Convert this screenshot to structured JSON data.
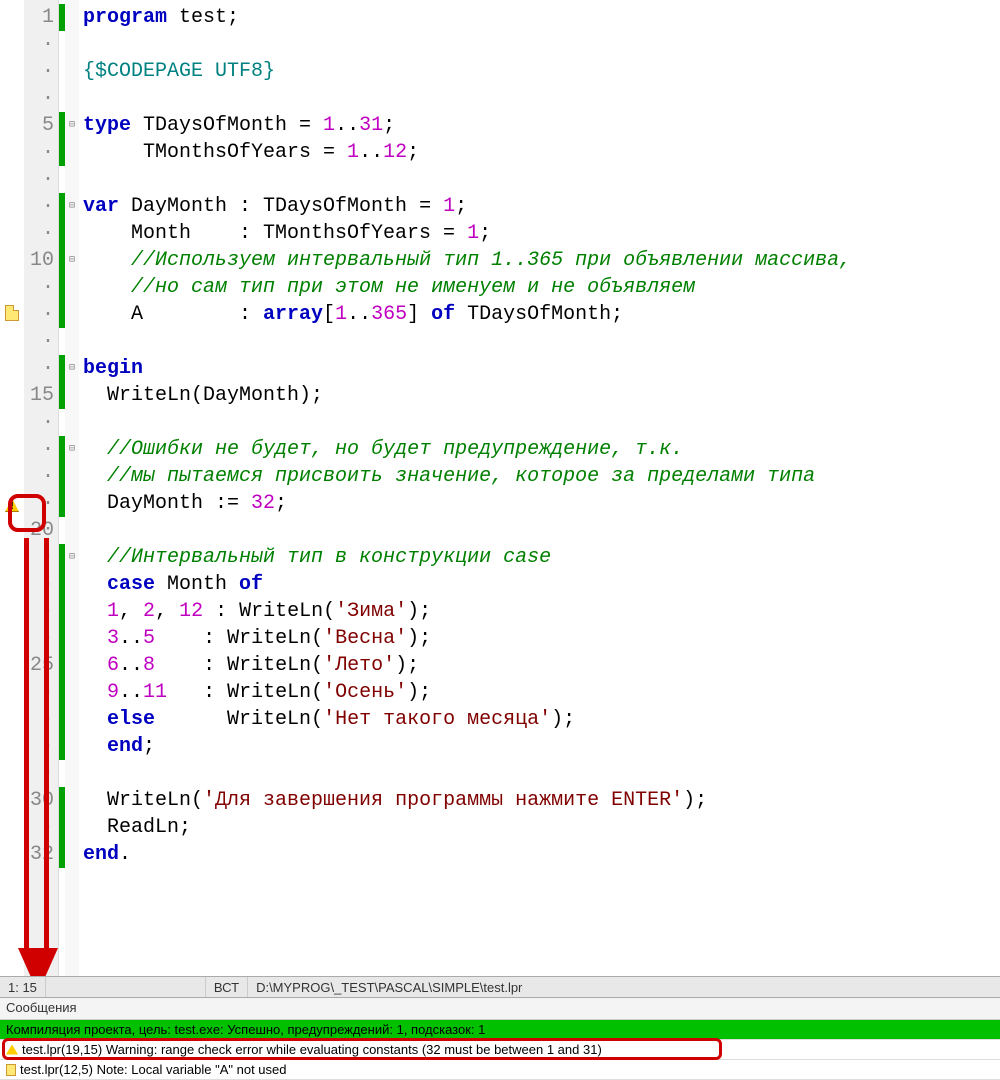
{
  "editor": {
    "lines": [
      {
        "n": "1",
        "t": [
          [
            "kw",
            "program"
          ],
          [
            "",
            " test;"
          ]
        ],
        "ch": true
      },
      {
        "n": "·",
        "t": [],
        "ch": false
      },
      {
        "n": "·",
        "t": [
          [
            "dir",
            "{$CODEPAGE UTF8}"
          ]
        ],
        "ch": false
      },
      {
        "n": "·",
        "t": [],
        "ch": false
      },
      {
        "n": "5",
        "t": [
          [
            "kw",
            "type"
          ],
          [
            "",
            " TDaysOfMonth = "
          ],
          [
            "num",
            "1"
          ],
          [
            "",
            ".."
          ],
          [
            "num",
            "31"
          ],
          [
            "",
            ";"
          ]
        ],
        "ch": true,
        "fold": "-"
      },
      {
        "n": "·",
        "t": [
          [
            "",
            "     TMonthsOfYears = "
          ],
          [
            "num",
            "1"
          ],
          [
            "",
            ".."
          ],
          [
            "num",
            "12"
          ],
          [
            "",
            ";"
          ]
        ],
        "ch": true
      },
      {
        "n": "·",
        "t": [],
        "ch": false
      },
      {
        "n": "·",
        "t": [
          [
            "kw",
            "var"
          ],
          [
            "",
            " DayMonth : TDaysOfMonth = "
          ],
          [
            "num",
            "1"
          ],
          [
            "",
            ";"
          ]
        ],
        "ch": true,
        "fold": "-"
      },
      {
        "n": "·",
        "t": [
          [
            "",
            "    Month    : TMonthsOfYears = "
          ],
          [
            "num",
            "1"
          ],
          [
            "",
            ";"
          ]
        ],
        "ch": true
      },
      {
        "n": "10",
        "t": [
          [
            "",
            "    "
          ],
          [
            "cmt",
            "//Используем интервальный тип 1..365 при объявлении массива,"
          ]
        ],
        "ch": true,
        "fold": "-"
      },
      {
        "n": "·",
        "t": [
          [
            "",
            "    "
          ],
          [
            "cmt",
            "//но сам тип при этом не именуем и не объявляем"
          ]
        ],
        "ch": true
      },
      {
        "n": "·",
        "t": [
          [
            "",
            "    A        : "
          ],
          [
            "kw",
            "array"
          ],
          [
            "",
            "["
          ],
          [
            "num",
            "1"
          ],
          [
            "",
            ".."
          ],
          [
            "num",
            "365"
          ],
          [
            "",
            "] "
          ],
          [
            "kw",
            "of"
          ],
          [
            "",
            " TDaysOfMonth;"
          ]
        ],
        "ch": true,
        "mark": "file"
      },
      {
        "n": "·",
        "t": [],
        "ch": false
      },
      {
        "n": "·",
        "t": [
          [
            "kw",
            "begin"
          ]
        ],
        "ch": true,
        "fold": "-"
      },
      {
        "n": "15",
        "t": [
          [
            "",
            "  WriteLn(DayMonth);"
          ]
        ],
        "ch": true
      },
      {
        "n": "·",
        "t": [],
        "ch": false
      },
      {
        "n": "·",
        "t": [
          [
            "",
            "  "
          ],
          [
            "cmt",
            "//Ошибки не будет, но будет предупреждение, т.к."
          ]
        ],
        "ch": true,
        "fold": "-"
      },
      {
        "n": "·",
        "t": [
          [
            "",
            "  "
          ],
          [
            "cmt",
            "//мы пытаемся присвоить значение, которое за пределами типа"
          ]
        ],
        "ch": true
      },
      {
        "n": "·",
        "t": [
          [
            "",
            "  DayMonth := "
          ],
          [
            "num",
            "32"
          ],
          [
            "",
            ";"
          ]
        ],
        "ch": true,
        "mark": "warn"
      },
      {
        "n": "20",
        "t": [],
        "ch": false
      },
      {
        "n": "·",
        "t": [
          [
            "",
            "  "
          ],
          [
            "cmt",
            "//Интервальный тип в конструкции case"
          ]
        ],
        "ch": true,
        "fold": "-"
      },
      {
        "n": "·",
        "t": [
          [
            "",
            "  "
          ],
          [
            "kw",
            "case"
          ],
          [
            "",
            " Month "
          ],
          [
            "kw",
            "of"
          ]
        ],
        "ch": true
      },
      {
        "n": "·",
        "t": [
          [
            "",
            "  "
          ],
          [
            "num",
            "1"
          ],
          [
            "",
            ", "
          ],
          [
            "num",
            "2"
          ],
          [
            "",
            ", "
          ],
          [
            "num",
            "12"
          ],
          [
            "",
            " : WriteLn("
          ],
          [
            "str",
            "'Зима'"
          ],
          [
            "",
            ");"
          ]
        ],
        "ch": true
      },
      {
        "n": "·",
        "t": [
          [
            "",
            "  "
          ],
          [
            "num",
            "3"
          ],
          [
            "",
            ".."
          ],
          [
            "num",
            "5"
          ],
          [
            "",
            "    : WriteLn("
          ],
          [
            "str",
            "'Весна'"
          ],
          [
            "",
            ");"
          ]
        ],
        "ch": true
      },
      {
        "n": "25",
        "t": [
          [
            "",
            "  "
          ],
          [
            "num",
            "6"
          ],
          [
            "",
            ".."
          ],
          [
            "num",
            "8"
          ],
          [
            "",
            "    : WriteLn("
          ],
          [
            "str",
            "'Лето'"
          ],
          [
            "",
            ");"
          ]
        ],
        "ch": true
      },
      {
        "n": "·",
        "t": [
          [
            "",
            "  "
          ],
          [
            "num",
            "9"
          ],
          [
            "",
            ".."
          ],
          [
            "num",
            "11"
          ],
          [
            "",
            "   : WriteLn("
          ],
          [
            "str",
            "'Осень'"
          ],
          [
            "",
            ");"
          ]
        ],
        "ch": true
      },
      {
        "n": "·",
        "t": [
          [
            "",
            "  "
          ],
          [
            "kw",
            "else"
          ],
          [
            "",
            "      WriteLn("
          ],
          [
            "str",
            "'Нет такого месяца'"
          ],
          [
            "",
            ");"
          ]
        ],
        "ch": true
      },
      {
        "n": "·",
        "t": [
          [
            "",
            "  "
          ],
          [
            "kw",
            "end"
          ],
          [
            "",
            ";"
          ]
        ],
        "ch": true
      },
      {
        "n": "·",
        "t": [],
        "ch": false
      },
      {
        "n": "30",
        "t": [
          [
            "",
            "  WriteLn("
          ],
          [
            "str",
            "'Для завершения программы нажмите ENTER'"
          ],
          [
            "",
            ");"
          ]
        ],
        "ch": true
      },
      {
        "n": "·",
        "t": [
          [
            "",
            "  ReadLn;"
          ]
        ],
        "ch": true
      },
      {
        "n": "32",
        "t": [
          [
            "kw",
            "end"
          ],
          [
            "",
            "."
          ]
        ],
        "ch": true
      }
    ]
  },
  "status": {
    "pos": "1: 15",
    "mode": "ВСТ",
    "path": "D:\\MYPROG\\_TEST\\PASCAL\\SIMPLE\\test.lpr"
  },
  "messages": {
    "title": "Сообщения",
    "compile": "Компиляция проекта, цель: test.exe: Успешно, предупреждений: 1, подсказок: 1",
    "warning": "test.lpr(19,15) Warning: range check error while evaluating constants (32 must be between 1 and 31)",
    "note": "test.lpr(12,5) Note: Local variable \"A\" not used"
  }
}
